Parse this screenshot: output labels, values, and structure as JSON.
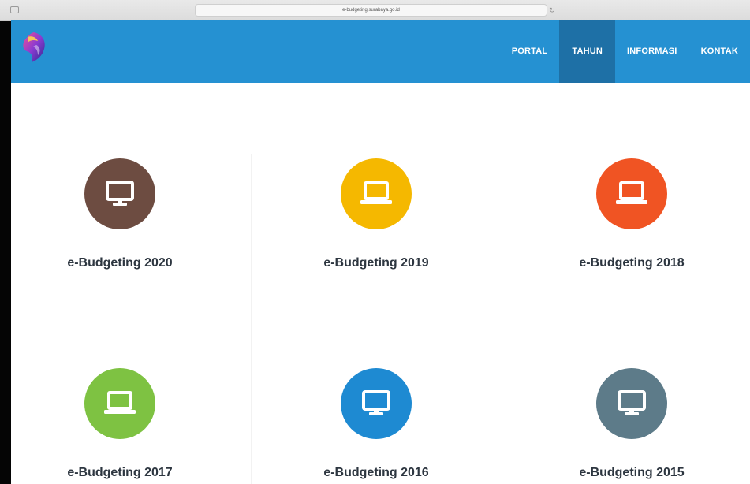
{
  "browser": {
    "url": "e-budgeting.surabaya.go.id"
  },
  "nav": {
    "items": [
      {
        "label": "PORTAL",
        "active": false
      },
      {
        "label": "TAHUN",
        "active": true
      },
      {
        "label": "INFORMASI",
        "active": false
      },
      {
        "label": "KONTAK",
        "active": false
      }
    ]
  },
  "cards": [
    {
      "title": "e-Budgeting 2020",
      "color": "#6d4c41",
      "icon": "monitor-icon"
    },
    {
      "title": "e-Budgeting 2019",
      "color": "#f5b800",
      "icon": "laptop-icon"
    },
    {
      "title": "e-Budgeting 2018",
      "color": "#f05423",
      "icon": "laptop-icon"
    },
    {
      "title": "e-Budgeting 2017",
      "color": "#7ec242",
      "icon": "laptop-icon"
    },
    {
      "title": "e-Budgeting 2016",
      "color": "#1e8ad2",
      "icon": "monitor-icon"
    },
    {
      "title": "e-Budgeting 2015",
      "color": "#5d7b89",
      "icon": "monitor-icon"
    }
  ],
  "colors": {
    "header": "#2591d2",
    "nav_active": "#1e70a6"
  }
}
